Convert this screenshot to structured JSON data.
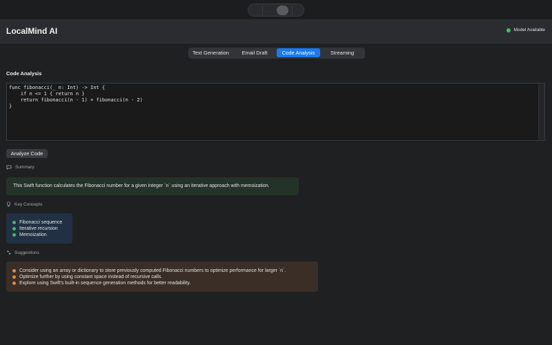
{
  "app": {
    "title": "LocalMind AI"
  },
  "status": {
    "label": "Model Available",
    "color": "#35c759"
  },
  "tabs": [
    {
      "label": "Text Generation",
      "active": false
    },
    {
      "label": "Email Draft",
      "active": false
    },
    {
      "label": "Code Analysis",
      "active": true
    },
    {
      "label": "Streaming",
      "active": false
    }
  ],
  "code_analysis": {
    "title": "Code Analysis",
    "code": "func fibonacci(_ n: Int) -> Int {\n    if n <= 1 { return n }\n    return fibonacci(n - 1) + fibonacci(n - 2)\n}",
    "analyze_button": "Analyze Code"
  },
  "summary": {
    "label": "Summary",
    "icon": "speech-bubble-icon",
    "text": "This Swift function calculates the Fibonacci number for a given integer `n` using an iterative approach with memoization."
  },
  "key_concepts": {
    "label": "Key Concepts",
    "icon": "lightbulb-icon",
    "items": [
      "Fibonacci sequence",
      "Iterative recursion",
      "Memoization"
    ]
  },
  "suggestions": {
    "label": "Suggestions",
    "icon": "sparkle-icon",
    "items": [
      "Consider using an array or dictionary to store previously computed Fibonacci numbers to optimize performance for larger `n`.",
      "Optimize further by using constant space instead of recursive calls.",
      "Explore using Swift's built-in sequence generation methods for better readability."
    ]
  },
  "colors": {
    "accent": "#1a7af0",
    "summary_bg": "#243329",
    "concepts_bg": "#213044",
    "suggestions_bg": "#3a2e27",
    "concept_bullet": "#3cc05a",
    "suggestion_bullet": "#e88a2a"
  }
}
